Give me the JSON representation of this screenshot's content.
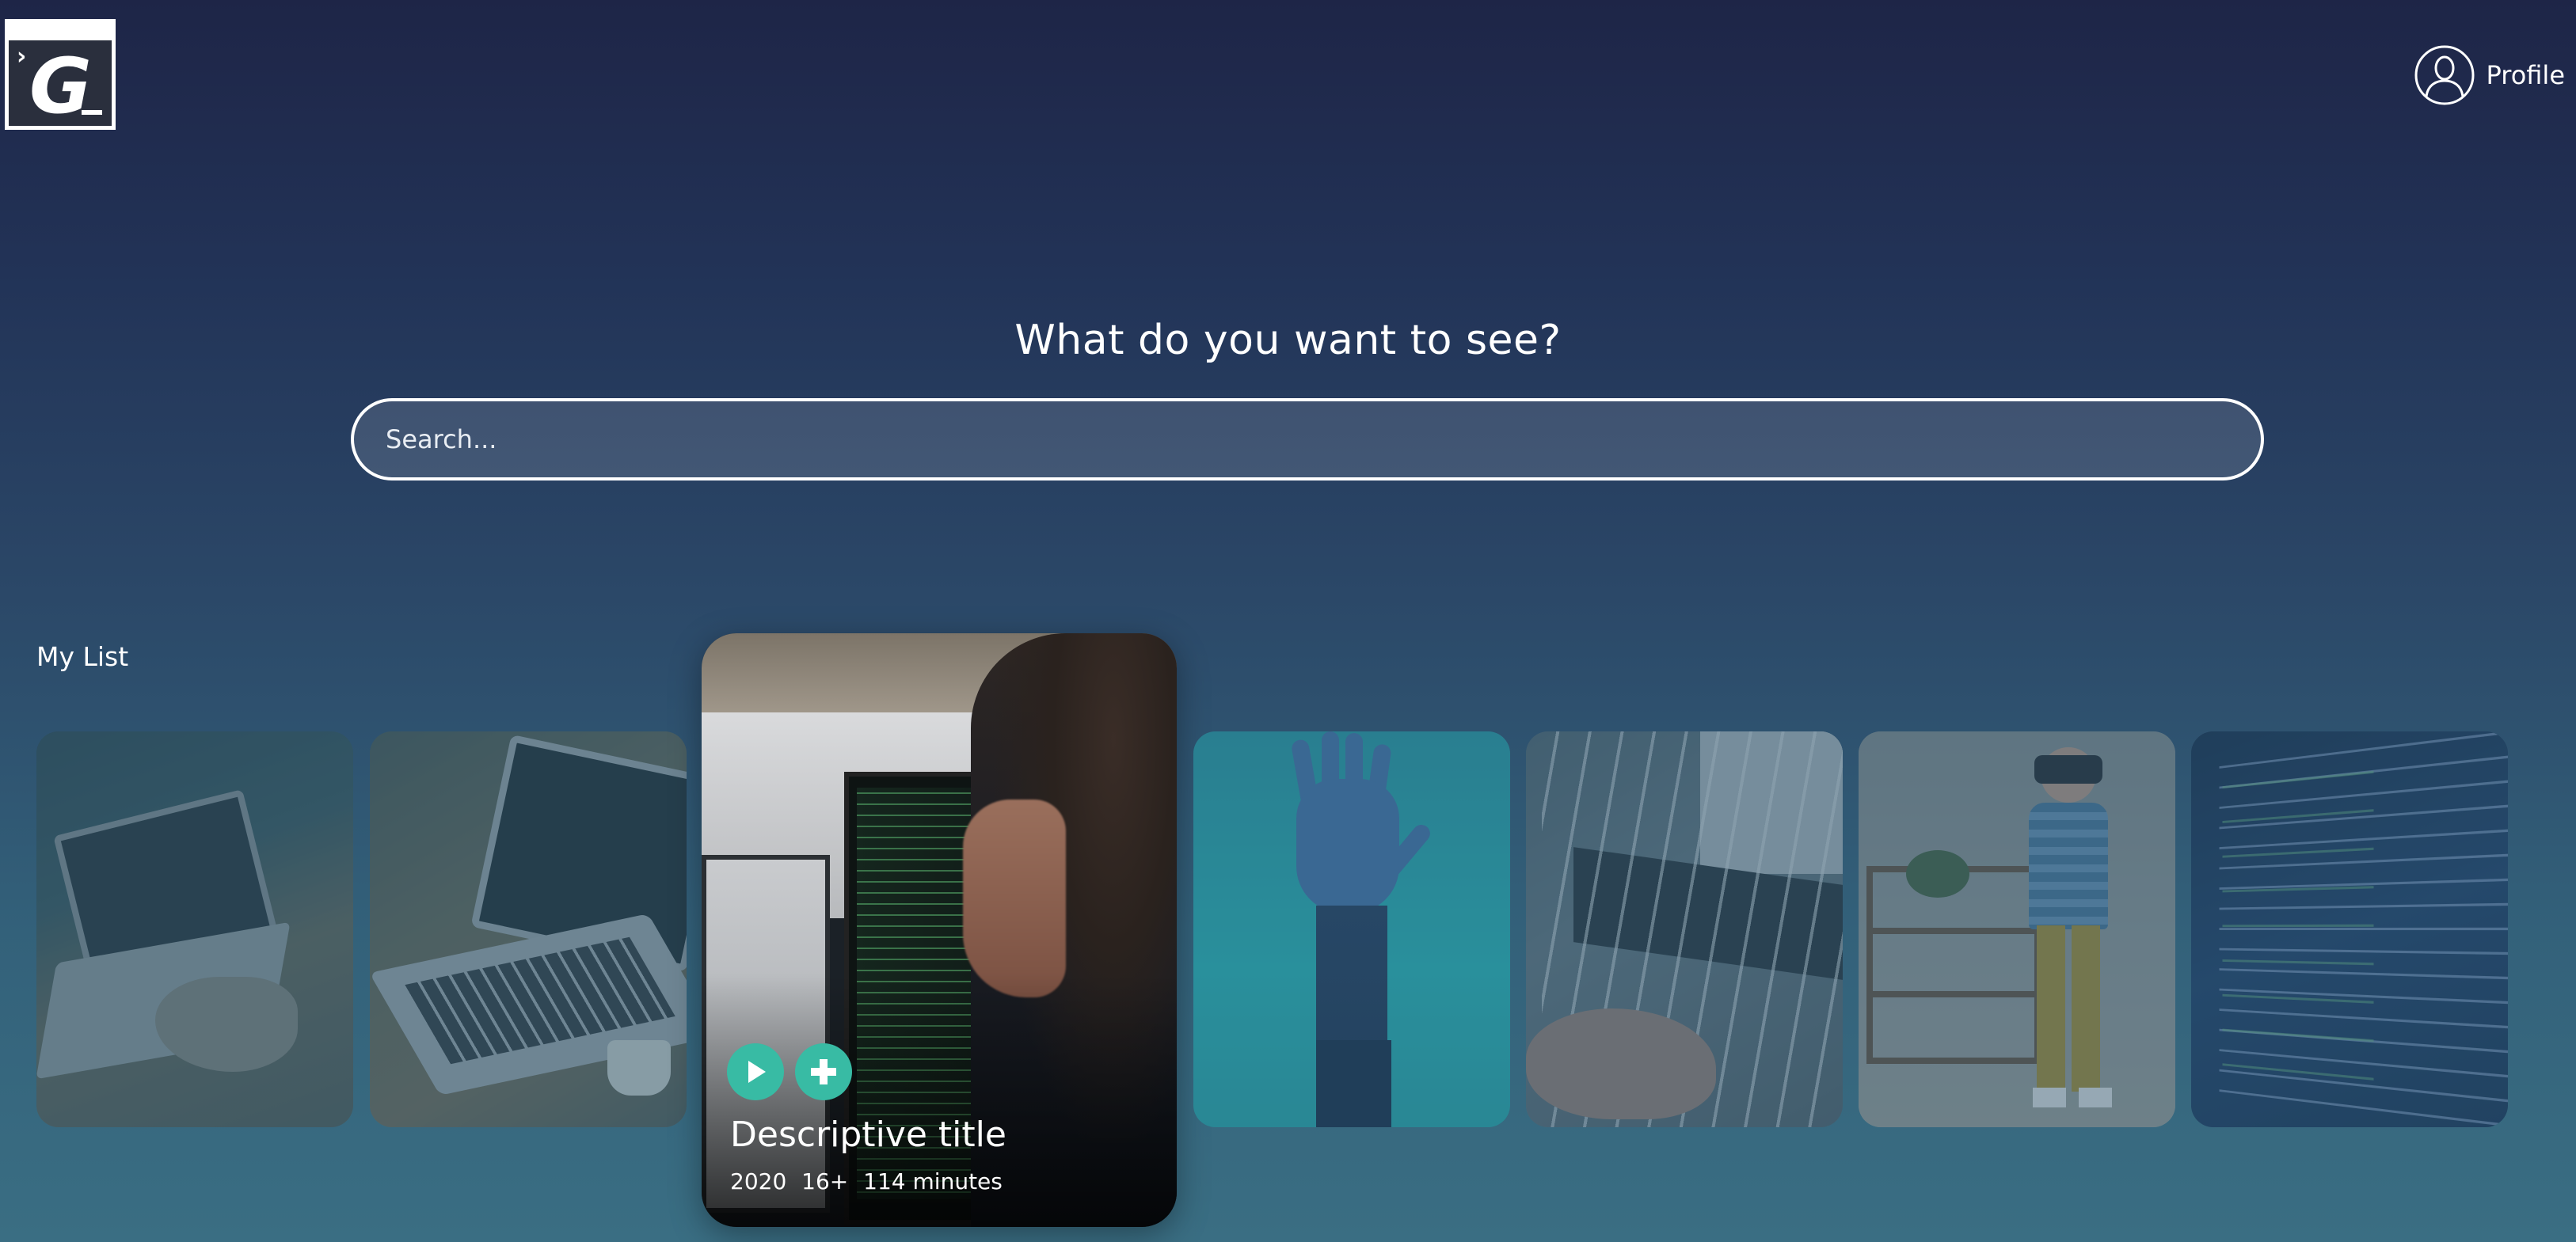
{
  "header": {
    "logo_letter": "G",
    "profile_label": "Profile"
  },
  "hero": {
    "title": "What do you want to see?",
    "search_placeholder": "Search..."
  },
  "my_list": {
    "title": "My List",
    "featured": {
      "title": "Descriptive title",
      "year": "2020",
      "rating": "16+",
      "duration": "114 minutes"
    },
    "icons": {
      "play": "play-icon",
      "add": "plus-icon",
      "profile": "user-icon"
    }
  },
  "colors": {
    "accent": "#38bba4",
    "bg_top": "#1e2547",
    "bg_bottom": "#3a6e83"
  }
}
